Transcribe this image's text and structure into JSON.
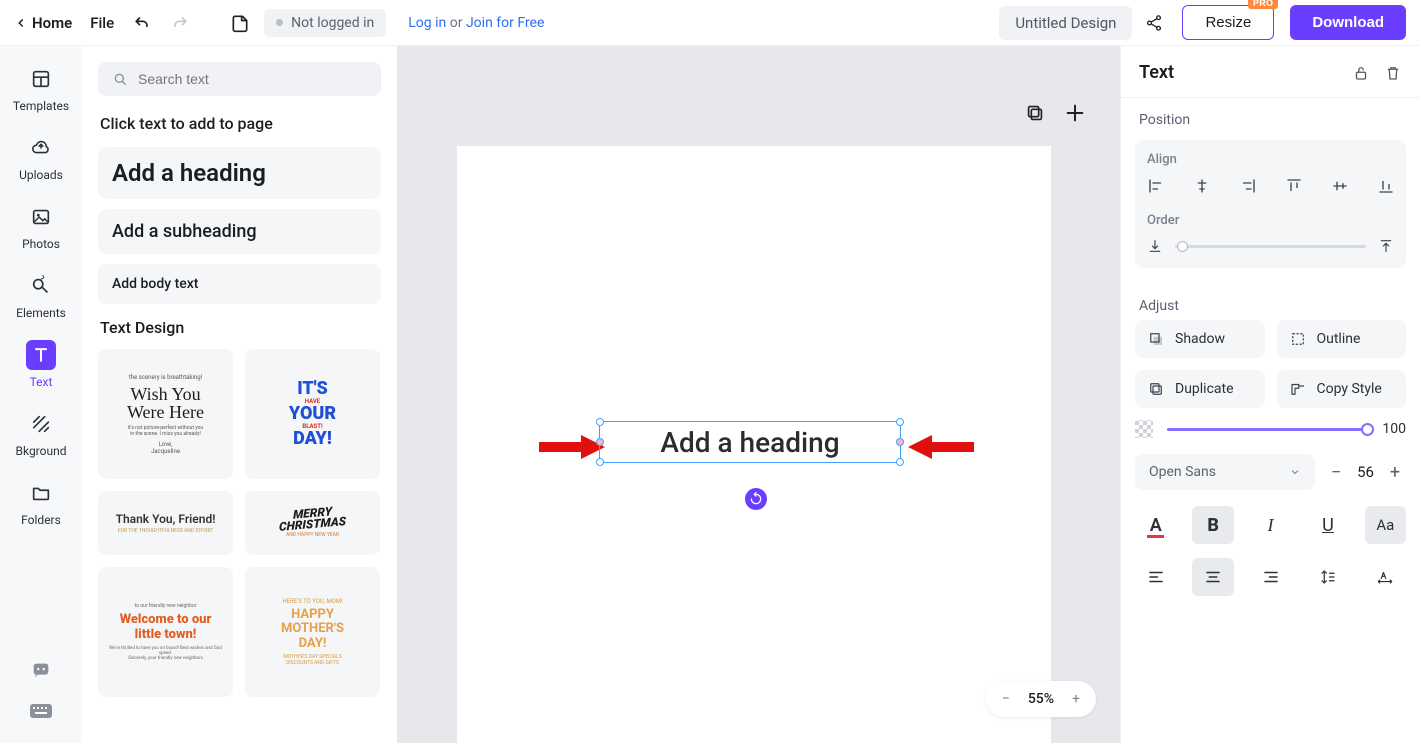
{
  "topbar": {
    "home": "Home",
    "file": "File",
    "status": "Not logged in",
    "login": "Log in",
    "or": "or",
    "join": "Join for Free",
    "title": "Untitled Design",
    "resize": "Resize",
    "pro": "PRO",
    "download": "Download"
  },
  "nav": {
    "templates": "Templates",
    "uploads": "Uploads",
    "photos": "Photos",
    "elements": "Elements",
    "text": "Text",
    "bkground": "Bkground",
    "folders": "Folders"
  },
  "panel": {
    "search_placeholder": "Search text",
    "prompt": "Click text to add to page",
    "heading": "Add a heading",
    "subheading": "Add a subheading",
    "body": "Add body text",
    "design_title": "Text Design"
  },
  "canvas": {
    "textbox": "Add a heading",
    "zoom": "55%"
  },
  "inspector": {
    "title": "Text",
    "position": "Position",
    "align": "Align",
    "order": "Order",
    "adjust": "Adjust",
    "shadow": "Shadow",
    "outline": "Outline",
    "duplicate": "Duplicate",
    "copy_style": "Copy Style",
    "opacity": "100",
    "font_name": "Open Sans",
    "font_size": "56"
  }
}
